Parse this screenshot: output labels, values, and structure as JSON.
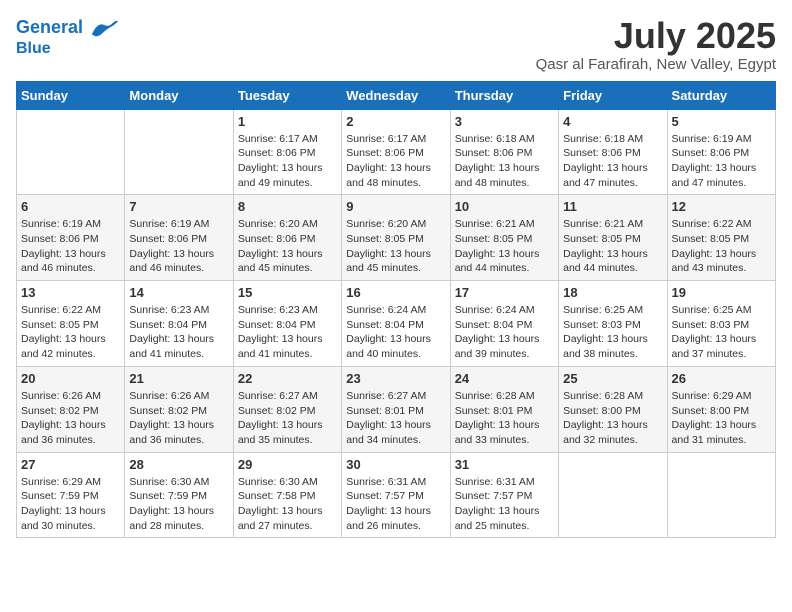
{
  "header": {
    "logo_line1": "General",
    "logo_line2": "Blue",
    "month": "July 2025",
    "location": "Qasr al Farafirah, New Valley, Egypt"
  },
  "weekdays": [
    "Sunday",
    "Monday",
    "Tuesday",
    "Wednesday",
    "Thursday",
    "Friday",
    "Saturday"
  ],
  "weeks": [
    [
      {
        "day": "",
        "info": ""
      },
      {
        "day": "",
        "info": ""
      },
      {
        "day": "1",
        "info": "Sunrise: 6:17 AM\nSunset: 8:06 PM\nDaylight: 13 hours and 49 minutes."
      },
      {
        "day": "2",
        "info": "Sunrise: 6:17 AM\nSunset: 8:06 PM\nDaylight: 13 hours and 48 minutes."
      },
      {
        "day": "3",
        "info": "Sunrise: 6:18 AM\nSunset: 8:06 PM\nDaylight: 13 hours and 48 minutes."
      },
      {
        "day": "4",
        "info": "Sunrise: 6:18 AM\nSunset: 8:06 PM\nDaylight: 13 hours and 47 minutes."
      },
      {
        "day": "5",
        "info": "Sunrise: 6:19 AM\nSunset: 8:06 PM\nDaylight: 13 hours and 47 minutes."
      }
    ],
    [
      {
        "day": "6",
        "info": "Sunrise: 6:19 AM\nSunset: 8:06 PM\nDaylight: 13 hours and 46 minutes."
      },
      {
        "day": "7",
        "info": "Sunrise: 6:19 AM\nSunset: 8:06 PM\nDaylight: 13 hours and 46 minutes."
      },
      {
        "day": "8",
        "info": "Sunrise: 6:20 AM\nSunset: 8:06 PM\nDaylight: 13 hours and 45 minutes."
      },
      {
        "day": "9",
        "info": "Sunrise: 6:20 AM\nSunset: 8:05 PM\nDaylight: 13 hours and 45 minutes."
      },
      {
        "day": "10",
        "info": "Sunrise: 6:21 AM\nSunset: 8:05 PM\nDaylight: 13 hours and 44 minutes."
      },
      {
        "day": "11",
        "info": "Sunrise: 6:21 AM\nSunset: 8:05 PM\nDaylight: 13 hours and 44 minutes."
      },
      {
        "day": "12",
        "info": "Sunrise: 6:22 AM\nSunset: 8:05 PM\nDaylight: 13 hours and 43 minutes."
      }
    ],
    [
      {
        "day": "13",
        "info": "Sunrise: 6:22 AM\nSunset: 8:05 PM\nDaylight: 13 hours and 42 minutes."
      },
      {
        "day": "14",
        "info": "Sunrise: 6:23 AM\nSunset: 8:04 PM\nDaylight: 13 hours and 41 minutes."
      },
      {
        "day": "15",
        "info": "Sunrise: 6:23 AM\nSunset: 8:04 PM\nDaylight: 13 hours and 41 minutes."
      },
      {
        "day": "16",
        "info": "Sunrise: 6:24 AM\nSunset: 8:04 PM\nDaylight: 13 hours and 40 minutes."
      },
      {
        "day": "17",
        "info": "Sunrise: 6:24 AM\nSunset: 8:04 PM\nDaylight: 13 hours and 39 minutes."
      },
      {
        "day": "18",
        "info": "Sunrise: 6:25 AM\nSunset: 8:03 PM\nDaylight: 13 hours and 38 minutes."
      },
      {
        "day": "19",
        "info": "Sunrise: 6:25 AM\nSunset: 8:03 PM\nDaylight: 13 hours and 37 minutes."
      }
    ],
    [
      {
        "day": "20",
        "info": "Sunrise: 6:26 AM\nSunset: 8:02 PM\nDaylight: 13 hours and 36 minutes."
      },
      {
        "day": "21",
        "info": "Sunrise: 6:26 AM\nSunset: 8:02 PM\nDaylight: 13 hours and 36 minutes."
      },
      {
        "day": "22",
        "info": "Sunrise: 6:27 AM\nSunset: 8:02 PM\nDaylight: 13 hours and 35 minutes."
      },
      {
        "day": "23",
        "info": "Sunrise: 6:27 AM\nSunset: 8:01 PM\nDaylight: 13 hours and 34 minutes."
      },
      {
        "day": "24",
        "info": "Sunrise: 6:28 AM\nSunset: 8:01 PM\nDaylight: 13 hours and 33 minutes."
      },
      {
        "day": "25",
        "info": "Sunrise: 6:28 AM\nSunset: 8:00 PM\nDaylight: 13 hours and 32 minutes."
      },
      {
        "day": "26",
        "info": "Sunrise: 6:29 AM\nSunset: 8:00 PM\nDaylight: 13 hours and 31 minutes."
      }
    ],
    [
      {
        "day": "27",
        "info": "Sunrise: 6:29 AM\nSunset: 7:59 PM\nDaylight: 13 hours and 30 minutes."
      },
      {
        "day": "28",
        "info": "Sunrise: 6:30 AM\nSunset: 7:59 PM\nDaylight: 13 hours and 28 minutes."
      },
      {
        "day": "29",
        "info": "Sunrise: 6:30 AM\nSunset: 7:58 PM\nDaylight: 13 hours and 27 minutes."
      },
      {
        "day": "30",
        "info": "Sunrise: 6:31 AM\nSunset: 7:57 PM\nDaylight: 13 hours and 26 minutes."
      },
      {
        "day": "31",
        "info": "Sunrise: 6:31 AM\nSunset: 7:57 PM\nDaylight: 13 hours and 25 minutes."
      },
      {
        "day": "",
        "info": ""
      },
      {
        "day": "",
        "info": ""
      }
    ]
  ]
}
